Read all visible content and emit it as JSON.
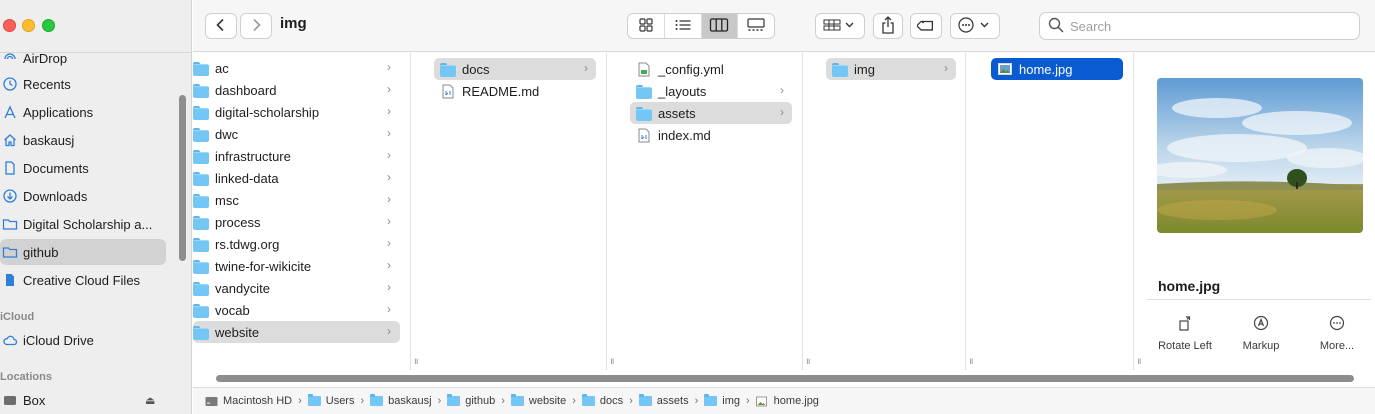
{
  "window": {
    "title": "img"
  },
  "sidebar": {
    "items": [
      {
        "label": "AirDrop",
        "icon": "airdrop-icon"
      },
      {
        "label": "Recents",
        "icon": "clock-icon"
      },
      {
        "label": "Applications",
        "icon": "applications-icon"
      },
      {
        "label": "baskausj",
        "icon": "home-icon"
      },
      {
        "label": "Documents",
        "icon": "document-icon"
      },
      {
        "label": "Downloads",
        "icon": "download-icon"
      },
      {
        "label": "Digital Scholarship a...",
        "icon": "folder-icon"
      },
      {
        "label": "github",
        "icon": "folder-icon",
        "selected": true
      },
      {
        "label": "Creative Cloud Files",
        "icon": "file-icon"
      }
    ],
    "icloud_header": "iCloud",
    "icloud_items": [
      {
        "label": "iCloud Drive",
        "icon": "cloud-icon"
      }
    ],
    "locations_header": "Locations",
    "locations_items": [
      {
        "label": "Box",
        "icon": "drive-icon"
      }
    ]
  },
  "toolbar": {
    "back_icon": "chevron-left-icon",
    "forward_icon": "chevron-right-icon",
    "view_modes": [
      "icon-view-icon",
      "list-view-icon",
      "column-view-icon",
      "gallery-view-icon"
    ],
    "active_view": "column-view-icon",
    "search_placeholder": "Search"
  },
  "columns": [
    {
      "items": [
        {
          "name": "ac",
          "type": "folder"
        },
        {
          "name": "dashboard",
          "type": "folder"
        },
        {
          "name": "digital-scholarship",
          "type": "folder"
        },
        {
          "name": "dwc",
          "type": "folder"
        },
        {
          "name": "infrastructure",
          "type": "folder"
        },
        {
          "name": "linked-data",
          "type": "folder"
        },
        {
          "name": "msc",
          "type": "folder"
        },
        {
          "name": "process",
          "type": "folder"
        },
        {
          "name": "rs.tdwg.org",
          "type": "folder"
        },
        {
          "name": "twine-for-wikicite",
          "type": "folder"
        },
        {
          "name": "vandycite",
          "type": "folder"
        },
        {
          "name": "vocab",
          "type": "folder"
        },
        {
          "name": "website",
          "type": "folder",
          "selected": true
        }
      ]
    },
    {
      "items": [
        {
          "name": "docs",
          "type": "folder",
          "selected": true
        },
        {
          "name": "README.md",
          "type": "file"
        }
      ]
    },
    {
      "items": [
        {
          "name": "_config.yml",
          "type": "file"
        },
        {
          "name": "_layouts",
          "type": "folder"
        },
        {
          "name": "assets",
          "type": "folder",
          "selected": true
        },
        {
          "name": "index.md",
          "type": "file"
        }
      ]
    },
    {
      "items": [
        {
          "name": "img",
          "type": "folder",
          "selected": true
        }
      ]
    },
    {
      "items": [
        {
          "name": "home.jpg",
          "type": "image",
          "selected": true,
          "active": true
        }
      ]
    }
  ],
  "preview": {
    "filename": "home.jpg",
    "actions": [
      {
        "label": "Rotate Left",
        "icon": "rotate-left-icon"
      },
      {
        "label": "Markup",
        "icon": "markup-icon"
      },
      {
        "label": "More...",
        "icon": "more-icon"
      }
    ]
  },
  "pathbar": {
    "crumbs": [
      {
        "label": "Macintosh HD",
        "icon": "drive-icon"
      },
      {
        "label": "Users",
        "icon": "folder-icon"
      },
      {
        "label": "baskausj",
        "icon": "folder-icon"
      },
      {
        "label": "github",
        "icon": "folder-icon"
      },
      {
        "label": "website",
        "icon": "folder-icon"
      },
      {
        "label": "docs",
        "icon": "folder-icon"
      },
      {
        "label": "assets",
        "icon": "folder-icon"
      },
      {
        "label": "img",
        "icon": "folder-icon"
      },
      {
        "label": "home.jpg",
        "icon": "image-icon"
      }
    ]
  },
  "colors": {
    "selection_blue": "#0a5bd2",
    "folder_blue": "#74c6f4",
    "sidebar_bg": "#efeeee"
  }
}
